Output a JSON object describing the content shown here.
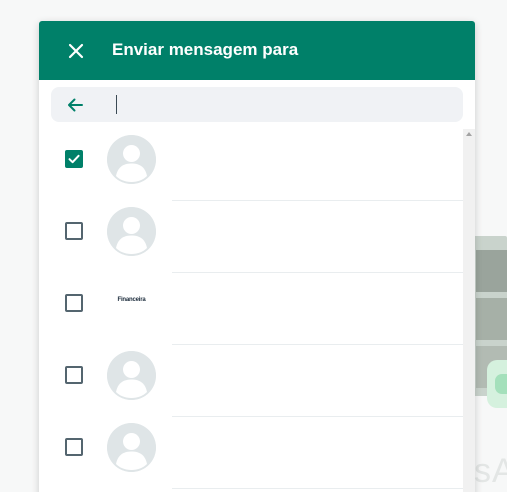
{
  "header": {
    "title": "Enviar mensagem para",
    "close_icon": "close-icon",
    "color": "#008069"
  },
  "search": {
    "back_icon": "arrow-left-icon",
    "value": "",
    "placeholder": ""
  },
  "contacts": [
    {
      "checked": true,
      "avatar": "default-avatar-icon"
    },
    {
      "checked": false,
      "avatar": "default-avatar-icon"
    },
    {
      "checked": false,
      "avatar": "logo",
      "logo_text": "Financeira"
    },
    {
      "checked": false,
      "avatar": "default-avatar-icon"
    },
    {
      "checked": false,
      "avatar": "default-avatar-icon"
    }
  ],
  "colors": {
    "accent": "#008069",
    "search_bg": "#f0f2f5",
    "avatar_bg": "#dfe5e7"
  }
}
